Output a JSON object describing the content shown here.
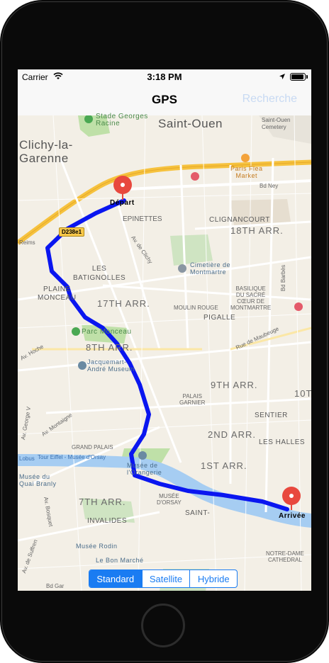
{
  "status_bar": {
    "carrier": "Carrier",
    "time": "3:18 PM"
  },
  "navbar": {
    "title": "GPS",
    "search_label": "Recherche"
  },
  "map": {
    "labels": {
      "stade_georges_racine": "Stade Georges\nRacine",
      "saint_ouen": "Saint-Ouen",
      "saint_ouen_cemetery": "Saint-Ouen\nCemetery",
      "clichy": "Clichy-la-\nGarenne",
      "paris_flea_market": "Paris Flea\nMarket",
      "bd_ney": "Bd Ney",
      "depart": "Départ",
      "epinettes": "EPINETTES",
      "d238e1": "D238e1",
      "clignancourt": "CLIGNANCOURT",
      "arr_18": "18TH ARR.",
      "reims": "Reims",
      "av_de_clichy": "Av. de Clichy",
      "les_batignolles": "LES\nBATIGNOLLES",
      "cimetiere": "Cimetière de\nMontmartre",
      "bd_barbes": "Bd Barbès",
      "plaine_monceau": "PLAINE\nMONCEAU",
      "arr_17": "17TH ARR.",
      "moulin_rouge": "MOULIN ROUGE",
      "basilique": "BASILIQUE\nDU SACRÉ\nCŒUR DE\nMONTMARTRE",
      "pigalle": "PIGALLE",
      "parc_monceau": "Parc Monceau",
      "arr_8": "8TH ARR.",
      "av_hoche": "Av. Hoche",
      "rue_de_maubeuge": "Rue de Maubeuge",
      "jacquemart": "Jacquemart-\nAndré Museum",
      "arr_9": "9TH ARR.",
      "arr_10": "10T",
      "palais_garnier": "PALAIS\nGARNIER",
      "sentier": "SENTIER",
      "av_george_v": "Av. George V",
      "av_montaigne": "Av. Montaigne",
      "grand_palais": "GRAND PALAIS",
      "arr_2": "2ND ARR.",
      "les_halles": "LES HALLES",
      "tour_eiffel": "Tour Eiffel - Musée d'Orsay",
      "lobus": "Lobus",
      "musee_orangerie": "Musée de\nl'Orangerie",
      "arr_1": "1ST ARR.",
      "quai_branly": "Musée du\nQuai Branly",
      "musee_orsay": "MUSÉE\nD'ORSAY",
      "arrivee": "Arrivée",
      "arr_7": "7TH ARR.",
      "saint_label": "SAINT-",
      "bosquet": "Av. Bosquet",
      "invalides": "INVALIDES",
      "notre_dame": "NOTRE-DAME\nCATHEDRAL",
      "av_suffren": "Av. de Suffren",
      "le_bon_marche": "Le Bon Marché",
      "musee_rodin": "Musée Rodin",
      "bd_gar": "Bd Gar"
    }
  },
  "map_type_control": {
    "options": [
      "Standard",
      "Satellite",
      "Hybride"
    ],
    "selected": "Standard"
  },
  "transport_control": {
    "options": [
      "car-icon",
      "walk-icon"
    ],
    "selected": "car-icon"
  },
  "colors": {
    "accent": "#1a7cf2",
    "route": "#0a16f0",
    "pin": "#e8483e",
    "highway": "#f6c23e",
    "park": "#bfe0a8",
    "water": "#a6cdf2"
  }
}
